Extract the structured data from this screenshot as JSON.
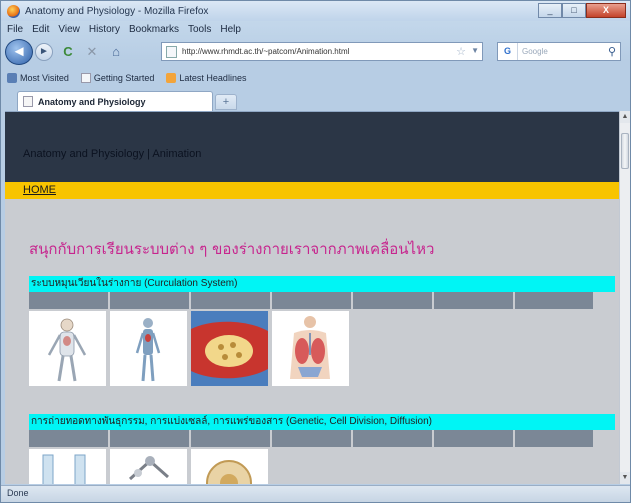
{
  "window": {
    "title": "Anatomy and Physiology - Mozilla Firefox",
    "minimize": "_",
    "maximize": "□",
    "close": "X"
  },
  "menu": [
    "File",
    "Edit",
    "View",
    "History",
    "Bookmarks",
    "Tools",
    "Help"
  ],
  "nav": {
    "back": "◄",
    "forward": "►",
    "reload": "C",
    "stop": "✕",
    "home": "⌂",
    "url": "http://www.rhmdt.ac.th/~patcom/Animation.html",
    "search_engine": "G",
    "search_placeholder": "Google"
  },
  "bookmarks": [
    "Most Visited",
    "Getting Started",
    "Latest Headlines"
  ],
  "tabs": [
    {
      "label": "Anatomy and Physiology"
    }
  ],
  "newtab": "+",
  "page": {
    "site_title": "Anatomy and Physiology | Animation",
    "home_link": "HOME",
    "headline": "สนุกกับการเรียนระบบต่าง ๆ ของร่างกายเราจากภาพเคลื่อนไหว",
    "sections": [
      {
        "title": "ระบบหมุนเวียนในร่างกาย (Curculation System)"
      },
      {
        "title": "การถ่ายทอดทางพันธุกรรม, การแบ่งเซลล์, การแพร่ของสาร (Genetic, Cell Division, Diffusion)"
      }
    ]
  },
  "status": "Done"
}
